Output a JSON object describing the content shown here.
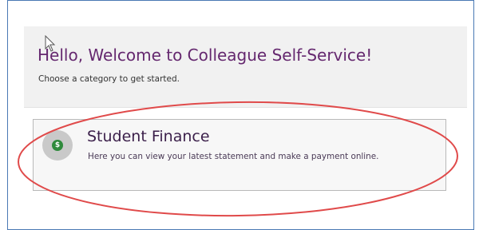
{
  "welcome": {
    "title": "Hello, Welcome to Colleague Self-Service!",
    "subtitle": "Choose a category to get started."
  },
  "category_card": {
    "icon": "dollar-coin-icon",
    "icon_glyph": "$",
    "title": "Student Finance",
    "description": "Here you can view your latest statement and make a payment online."
  },
  "colors": {
    "frame_border": "#4a79b4",
    "welcome_title": "#65286f",
    "annotation_circle": "#e04a4a",
    "icon_green": "#2f8a3c"
  }
}
